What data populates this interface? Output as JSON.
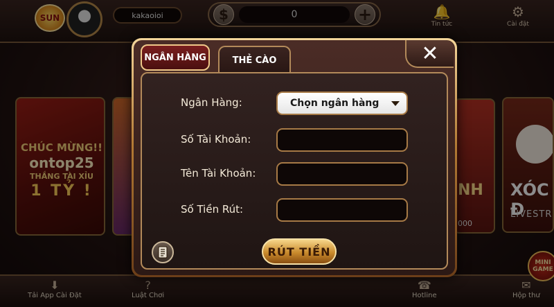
{
  "header": {
    "logo_text": "SUN",
    "username": "kakaoioi",
    "currency_symbol": "$",
    "balance": "0",
    "plus_symbol": "+",
    "news_label": "Tin tức",
    "settings_label": "Cài đặt"
  },
  "background": {
    "promo": {
      "line1": "CHÚC MỪNG!!",
      "line2": "ontop25",
      "line3": "THẮNG TÀI XỈU",
      "line4": "1 TỶ !"
    },
    "right_card_text": "NH",
    "right_card_number": "000",
    "xoc_title": "XÓC Đ",
    "xoc_sub": "LIVESTR",
    "mini_game": "MINI GAME"
  },
  "footer": {
    "app_install": "Tải App Cài Đặt",
    "rules": "Luật Chơi",
    "hotline": "Hotline",
    "messages": "Hộp thư"
  },
  "modal": {
    "tabs": [
      {
        "label": "NGÂN HÀNG",
        "active": true
      },
      {
        "label": "THẺ CÀO",
        "active": false
      }
    ],
    "close_symbol": "✕",
    "fields": {
      "bank_label": "Ngân Hàng:",
      "bank_select_value": "Chọn ngân hàng",
      "account_number_label": "Số Tài Khoản:",
      "account_number_value": "",
      "account_name_label": "Tên Tài Khoản:",
      "account_name_value": "",
      "amount_label": "Số Tiền Rút:",
      "amount_value": ""
    },
    "withdraw_button": "RÚT TIỀN"
  },
  "colors": {
    "accent_gold": "#f0c98a",
    "active_tab": "#7a1f1f",
    "panel_bg": "#2c1915"
  }
}
